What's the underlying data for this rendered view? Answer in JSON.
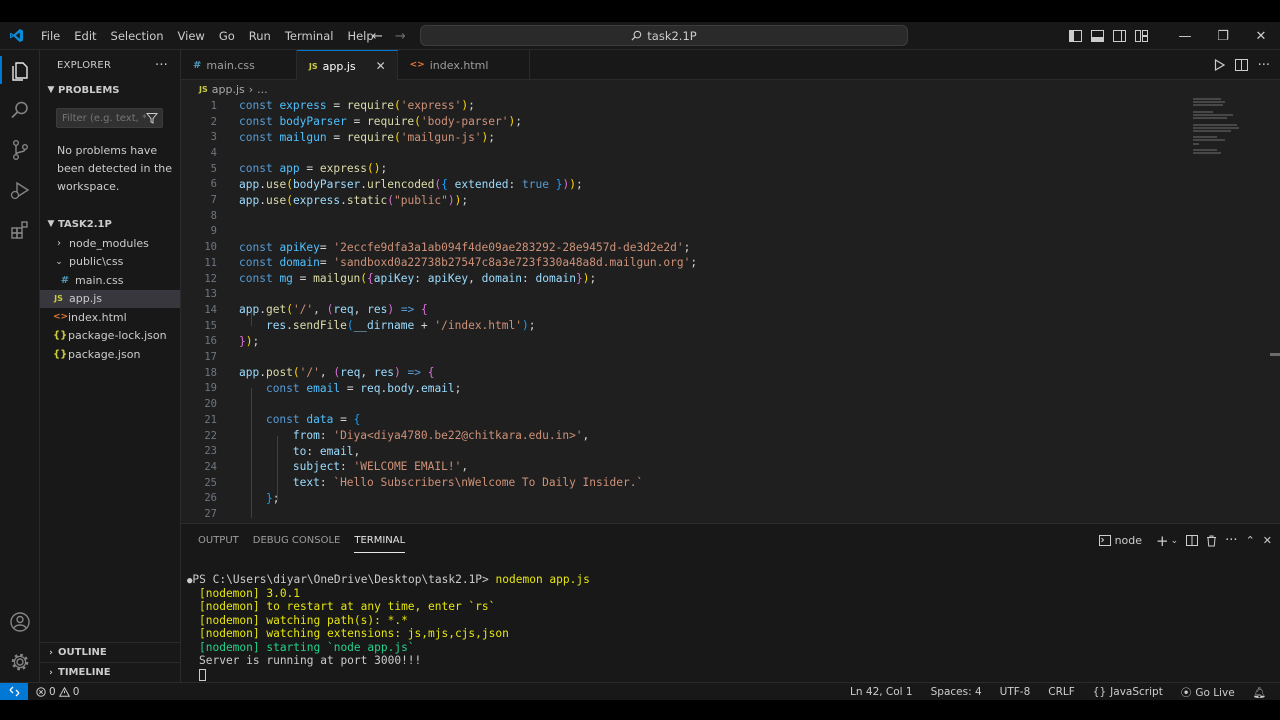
{
  "menu": [
    "File",
    "Edit",
    "Selection",
    "View",
    "Go",
    "Run",
    "Terminal",
    "Help"
  ],
  "command_center": "task2.1P",
  "colors": {
    "accent": "#0078d4",
    "editor_bg": "#1f1f1f",
    "sidebar_bg": "#181818"
  },
  "sidebar": {
    "explorer_title": "EXPLORER",
    "problems": {
      "title": "PROBLEMS",
      "filter_placeholder": "Filter (e.g. text, *...",
      "message": "No problems have been detected in the workspace."
    },
    "folder_title": "TASK2.1P",
    "tree": [
      {
        "label": "node_modules",
        "icon": "chevron-right-icon"
      },
      {
        "label": "public\\css",
        "icon": "chevron-down-icon"
      },
      {
        "label": "main.css",
        "icon": "css-file-icon"
      },
      {
        "label": "app.js",
        "icon": "js-file-icon"
      },
      {
        "label": "index.html",
        "icon": "html-file-icon"
      },
      {
        "label": "package-lock.json",
        "icon": "json-file-icon"
      },
      {
        "label": "package.json",
        "icon": "json-file-icon"
      }
    ],
    "outline": "OUTLINE",
    "timeline": "TIMELINE"
  },
  "tabs": [
    {
      "label": "main.css",
      "icon": "#"
    },
    {
      "label": "app.js",
      "icon": "JS"
    },
    {
      "label": "index.html",
      "icon": "<>"
    }
  ],
  "breadcrumbs": {
    "file": "app.js",
    "rest": "..."
  },
  "editor": {
    "line_numbers": [
      "1",
      "2",
      "3",
      "4",
      "5",
      "6",
      "7",
      "8",
      "9",
      "10",
      "11",
      "12",
      "13",
      "14",
      "15",
      "16",
      "17",
      "18",
      "19",
      "20",
      "21",
      "22",
      "23",
      "24",
      "25",
      "26",
      "27"
    ],
    "code": {
      "apiKey": "'2eccfe9dfa3a1ab094f4de09ae283292-28e9457d-de3d2e2d'",
      "domain": "'sandboxd0a22738b27547c8a3e723f330a48a8d.mailgun.org'",
      "from": "'Diya<diya4780.be22@chitkara.edu.in>'",
      "subject": "'WELCOME EMAIL!'",
      "text": "`Hello Subscribers\\nWelcome To Daily Insider.`"
    }
  },
  "panel": {
    "tabs": [
      "OUTPUT",
      "DEBUG CONSOLE",
      "TERMINAL"
    ],
    "terminal_name": "node",
    "prompt": "PS C:\\Users\\diyar\\OneDrive\\Desktop\\task2.1P> ",
    "command": "nodemon app.js",
    "lines": [
      "[nodemon] 3.0.1",
      "[nodemon] to restart at any time, enter `rs`",
      "[nodemon] watching path(s): *.*",
      "[nodemon] watching extensions: js,mjs,cjs,json",
      "[nodemon] starting `node app.js`",
      "Server is running at port 3000!!!"
    ]
  },
  "status": {
    "errors": "0",
    "warnings": "0",
    "position": "Ln 42, Col 1",
    "spaces": "Spaces: 4",
    "encoding": "UTF-8",
    "eol": "CRLF",
    "language": "JavaScript",
    "golive": "Go Live"
  }
}
